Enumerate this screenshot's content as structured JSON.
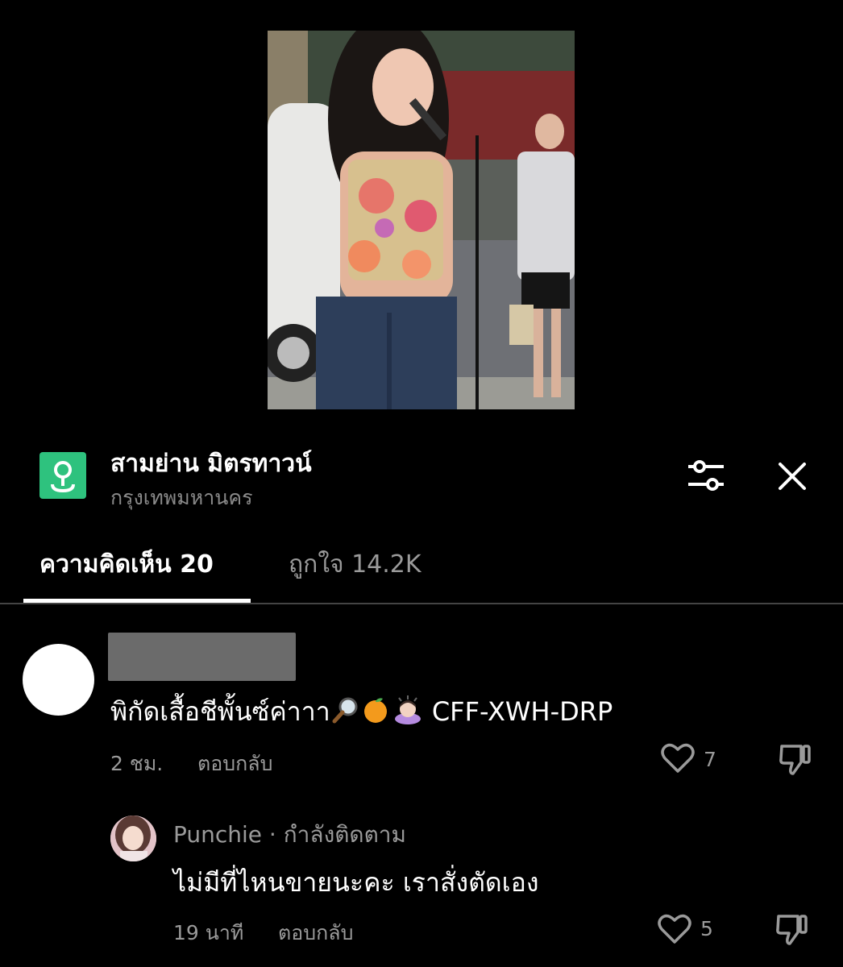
{
  "location": {
    "title": "สามย่าน มิตรทาวน์",
    "subtitle": "กรุงเทพมหานคร"
  },
  "tabs": [
    {
      "label": "ความคิดเห็น 20",
      "active": true
    },
    {
      "label": "ถูกใจ 14.2K",
      "active": false
    }
  ],
  "comments": [
    {
      "text": "พิกัดเสื้อชีพั้นซ์ค่าาา",
      "code": "CFF-XWH-DRP",
      "time": "2 ชม.",
      "reply_label": "ตอบกลับ",
      "likes": "7",
      "replies": [
        {
          "author": "Punchie · กำลังติดตาม",
          "text": "ไม่มีที่ไหนขายนะคะ เราสั่งตัดเอง",
          "time": "19 นาที",
          "reply_label": "ตอบกลับ",
          "likes": "5"
        }
      ]
    }
  ],
  "icons": {
    "location": "map-pin-icon",
    "filter": "sliders-icon",
    "close": "close-icon",
    "like": "heart-outline-icon",
    "dislike": "thumbs-down-icon"
  },
  "colors": {
    "accent_green": "#2ec27e",
    "muted_text": "#9a9a9a",
    "background": "#000000"
  }
}
